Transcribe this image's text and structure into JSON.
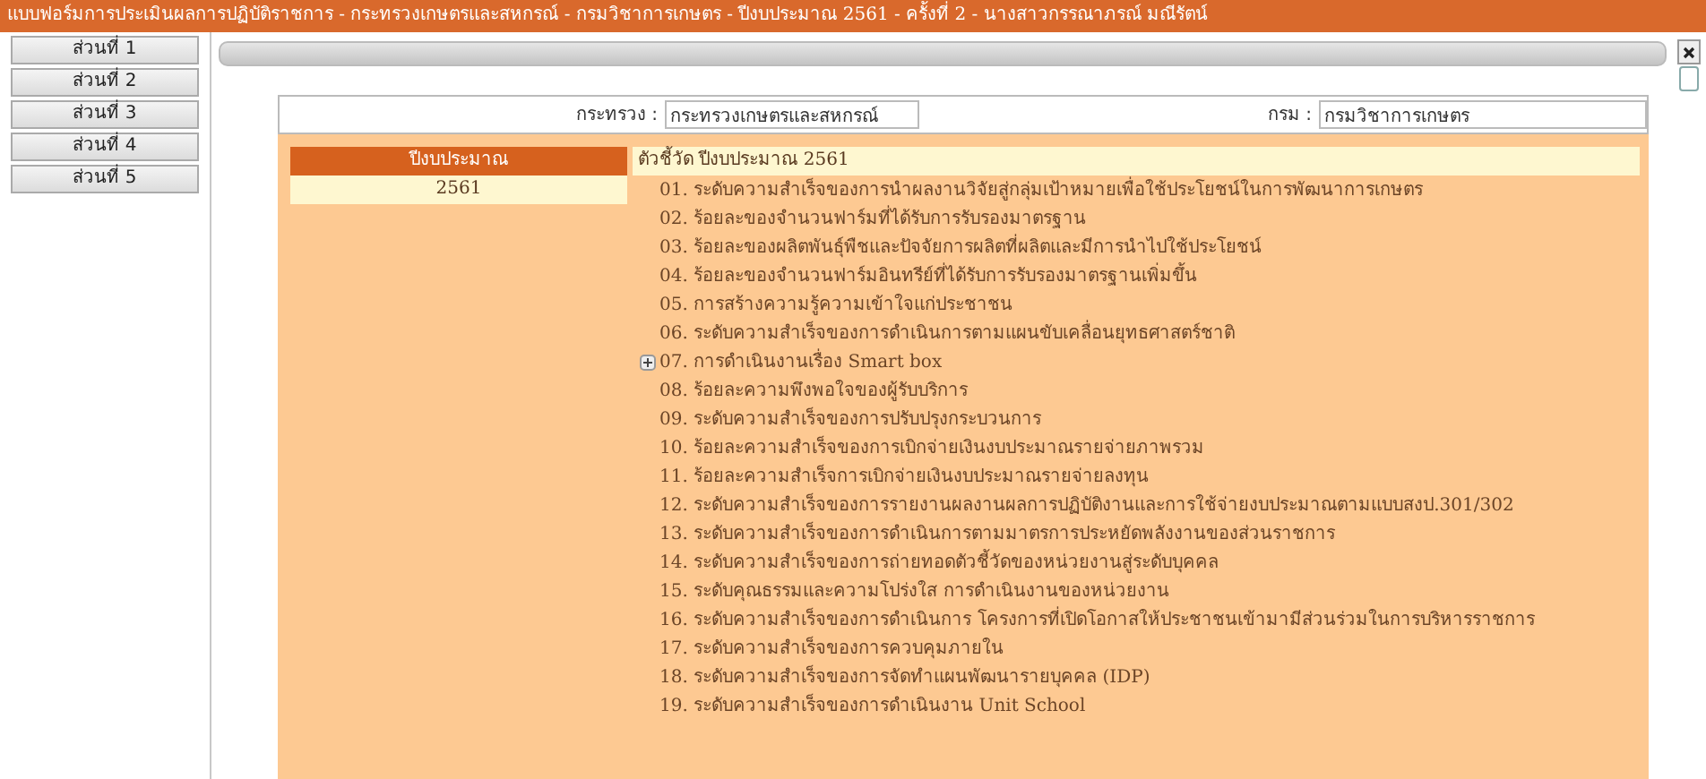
{
  "window": {
    "title": "แบบฟอร์มการประเมินผลการปฏิบัติราชการ - กระทรวงเกษตรและสหกรณ์ - กรมวิชาการเกษตร - ปีงบประมาณ 2561 - ครั้งที่ 2 - นางสาวกรรณาภรณ์ มณีรัตน์"
  },
  "sidebar": {
    "items": [
      "ส่วนที่ 1",
      "ส่วนที่ 2",
      "ส่วนที่ 3",
      "ส่วนที่ 4",
      "ส่วนที่ 5"
    ]
  },
  "form": {
    "ministry": {
      "label": "กระทรวง :",
      "value": "กระทรวงเกษตรและสหกรณ์"
    },
    "department": {
      "label": "กรม :",
      "value": "กรมวิชาการเกษตร"
    }
  },
  "years": {
    "heading": "ปีงบประมาณ",
    "rows": [
      "2561"
    ]
  },
  "indicators": {
    "heading": "ตัวชี้วัด ปีงบประมาณ 2561",
    "items": [
      {
        "kind": "item",
        "label": "01. ระดับความสำเร็จของการนำผลงานวิจัยสู่กลุ่มเป้าหมายเพื่อใช้ประโยชน์ในการพัฒนาการเกษตร"
      },
      {
        "kind": "item",
        "label": "02. ร้อยละของจำนวนฟาร์มที่ได้รับการรับรองมาตรฐาน"
      },
      {
        "kind": "item",
        "label": "03. ร้อยละของผลิตพันธุ์พืชและปัจจัยการผลิตที่ผลิตและมีการนำไปใช้ประโยชน์"
      },
      {
        "kind": "item",
        "label": "04. ร้อยละของจำนวนฟาร์มอินทรีย์ที่ได้รับการรับรองมาตรฐานเพิ่มขึ้น"
      },
      {
        "kind": "item",
        "label": "05. การสร้างความรู้ความเข้าใจแก่ประชาชน"
      },
      {
        "kind": "item",
        "label": "06. ระดับความสำเร็จของการดำเนินการตามแผนขับเคลื่อนยุทธศาสตร์ชาติ"
      },
      {
        "kind": "group",
        "label": "07. การดำเนินงานเรื่อง Smart box"
      },
      {
        "kind": "item",
        "label": "08. ร้อยละความพึงพอใจของผู้รับบริการ"
      },
      {
        "kind": "item",
        "label": "09. ระดับความสำเร็จของการปรับปรุงกระบวนการ"
      },
      {
        "kind": "item",
        "label": "10. ร้อยละความสำเร็จของการเบิกจ่ายเงินงบประมาณรายจ่ายภาพรวม"
      },
      {
        "kind": "item",
        "label": "11. ร้อยละความสำเร็จการเบิกจ่ายเงินงบประมาณรายจ่ายลงทุน"
      },
      {
        "kind": "item",
        "label": "12. ระดับความสำเร็จของการรายงานผลงานผลการปฏิบัติงานและการใช้จ่ายงบประมาณตามแบบสงป.301/302"
      },
      {
        "kind": "item",
        "label": "13. ระดับความสำเร็จของการดำเนินการตามมาตรการประหยัดพลังงานของส่วนราชการ"
      },
      {
        "kind": "item",
        "label": "14. ระดับความสำเร็จของการถ่ายทอดตัวชี้วัดของหน่วยงานสู่ระดับบุคคล"
      },
      {
        "kind": "item",
        "label": "15. ระดับคุณธรรมและความโปร่งใส การดำเนินงานของหน่วยงาน"
      },
      {
        "kind": "item",
        "label": "16. ระดับความสำเร็จของการดำเนินการ โครงการที่เปิดโอกาสให้ประชาชนเข้ามามีส่วนร่วมในการบริหารราชการ"
      },
      {
        "kind": "item",
        "label": "17. ระดับความสำเร็จของการควบคุมภายใน"
      },
      {
        "kind": "item",
        "label": "18. ระดับความสำเร็จของการจัดทำแผนพัฒนารายบุคคล (IDP)"
      },
      {
        "kind": "item",
        "label": "19. ระดับความสำเร็จของการดำเนินงาน Unit School"
      }
    ]
  }
}
